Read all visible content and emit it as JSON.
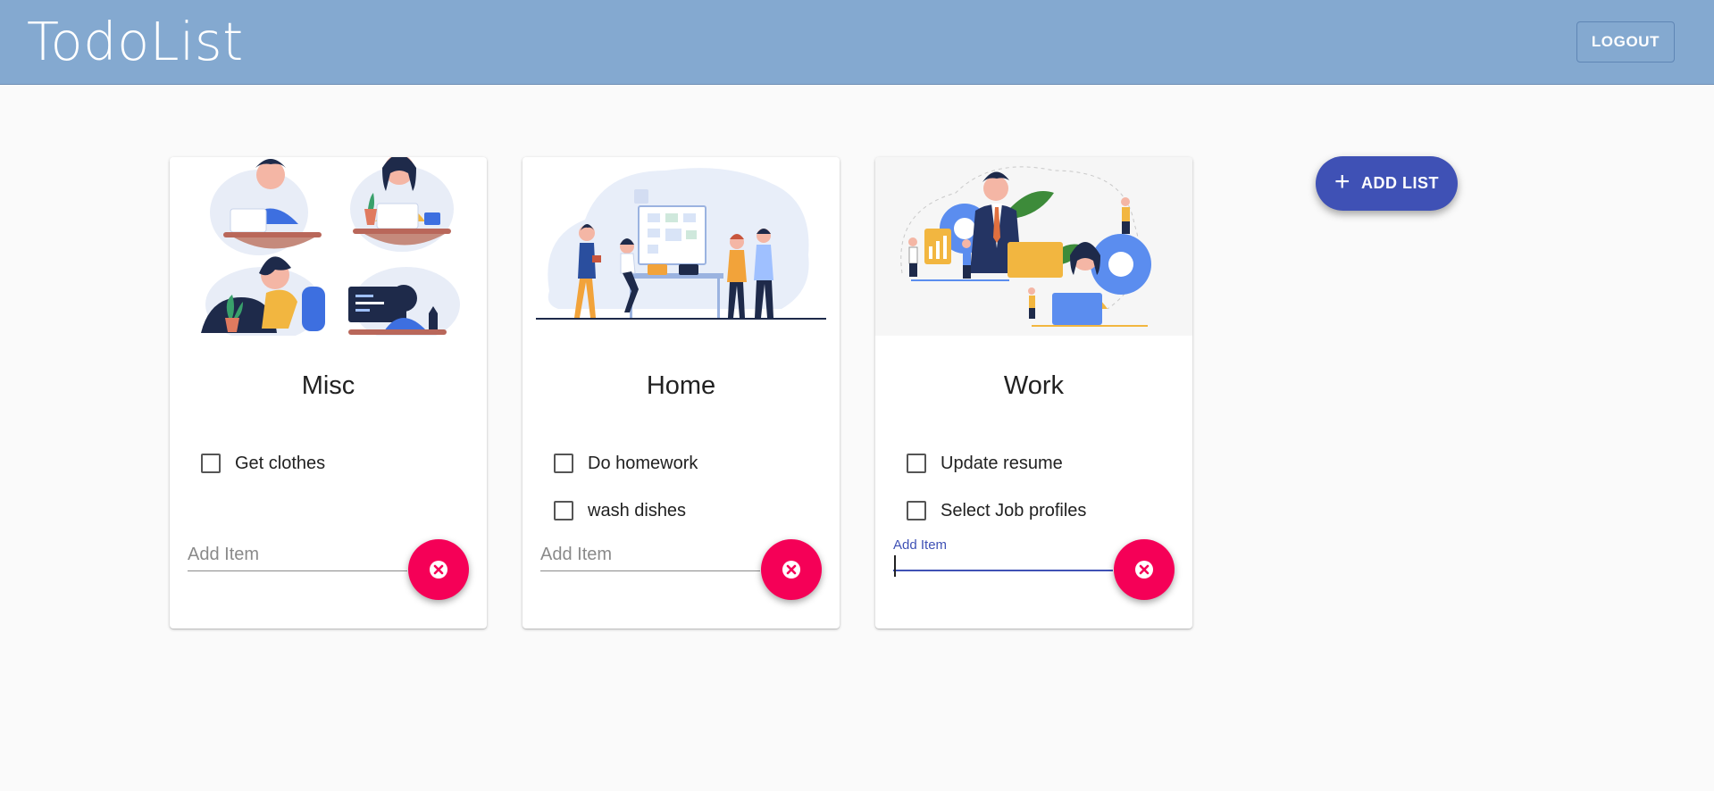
{
  "header": {
    "title": "TodoList",
    "logout_label": "LOGOUT"
  },
  "add_list": {
    "label": "ADD LIST",
    "icon": "plus-icon"
  },
  "lists": [
    {
      "title": "Misc",
      "illustration": "people-working-at-laptops",
      "items": [
        {
          "label": "Get clothes",
          "checked": false
        }
      ],
      "add_item_placeholder": "Add Item",
      "add_item_value": "",
      "focused": false
    },
    {
      "title": "Home",
      "illustration": "team-at-whiteboard",
      "items": [
        {
          "label": "Do homework",
          "checked": false
        },
        {
          "label": "wash dishes",
          "checked": false
        }
      ],
      "add_item_placeholder": "Add Item",
      "add_item_value": "",
      "focused": false
    },
    {
      "title": "Work",
      "illustration": "business-team-with-gears",
      "items": [
        {
          "label": "Update resume",
          "checked": false
        },
        {
          "label": "Select Job profiles",
          "checked": false
        }
      ],
      "add_item_label": "Add Item",
      "add_item_value": "",
      "focused": true
    }
  ],
  "colors": {
    "appbar": "#84a9d0",
    "primary": "#3f51b5",
    "delete_fab": "#f50057",
    "background": "#fafafa"
  }
}
